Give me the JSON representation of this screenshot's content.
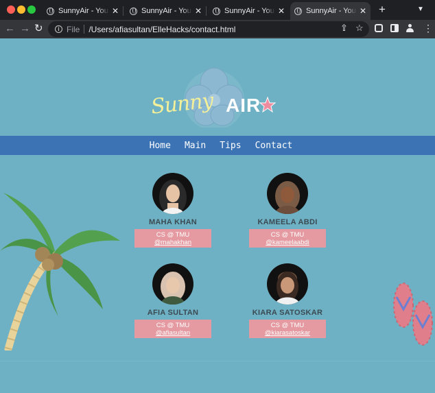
{
  "browser": {
    "tabs": [
      {
        "title": "SunnyAir - Your Su",
        "active": false
      },
      {
        "title": "SunnyAir - Your Su",
        "active": false
      },
      {
        "title": "SunnyAir - Your Su",
        "active": false
      },
      {
        "title": "SunnyAir - Your Su",
        "active": true
      }
    ],
    "scheme": "File",
    "url": "/Users/afiasultan/ElleHacks/contact.html"
  },
  "site": {
    "logo": {
      "part1": "Sunny",
      "part2": "AIR"
    },
    "nav": [
      "Home",
      "Main",
      "Tips",
      "Contact"
    ],
    "team": [
      {
        "name": "MAHA KHAN",
        "role": "CS @ TMU",
        "handle": "@mahakhan"
      },
      {
        "name": "KAMEELA ABDI",
        "role": "CS @ TMU",
        "handle": "@kameelaabdi"
      },
      {
        "name": "AFIA SULTAN",
        "role": "CS @ TMU",
        "handle": "@afiasultan"
      },
      {
        "name": "KIARA SATOSKAR",
        "role": "CS @ TMU",
        "handle": "@kiarasatoskar"
      }
    ]
  },
  "colors": {
    "page_bg": "#6fb1c4",
    "navbar": "#3c73b4",
    "card": "#e49aa0",
    "logo_yellow": "#f4f09a",
    "star_pink": "#ef8da0"
  },
  "icons": [
    "globe-icon",
    "close-icon",
    "plus-icon",
    "back-icon",
    "forward-icon",
    "reload-icon",
    "info-icon",
    "share-icon",
    "star-icon",
    "extension-icon",
    "side-panel-icon",
    "profile-icon",
    "menu-icon"
  ]
}
